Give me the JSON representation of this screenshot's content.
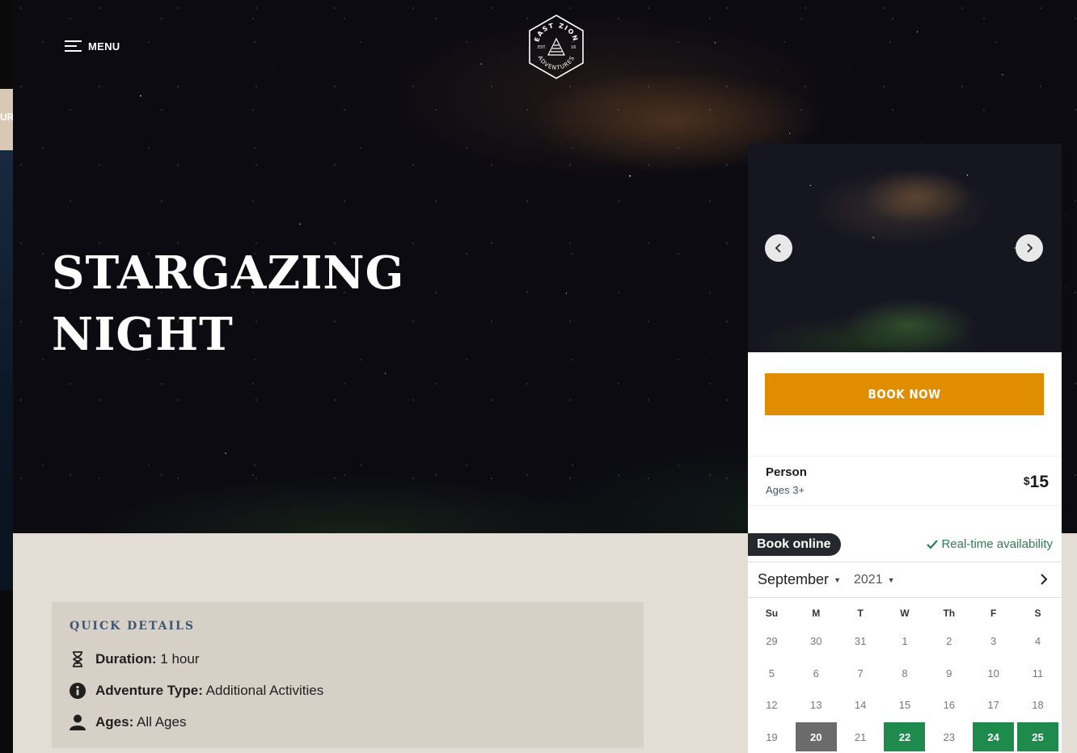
{
  "header": {
    "menu_label": "MENU",
    "logo_text_top": "EAST ZION",
    "logo_text_bottom": "ADVENTURES",
    "logo_est": "EST.",
    "logo_year": "16"
  },
  "left_strip_text": "UR",
  "hero": {
    "title_line1": "STARGAZING",
    "title_line2": "NIGHT"
  },
  "quick_details": {
    "title": "QUICK DETAILS",
    "items": [
      {
        "label": "Duration:",
        "value": "1 hour",
        "icon": "hourglass-icon"
      },
      {
        "label": "Adventure Type:",
        "value": "Additional Activities",
        "icon": "info-icon"
      },
      {
        "label": "Ages:",
        "value": "All Ages",
        "icon": "person-icon"
      }
    ]
  },
  "booking": {
    "book_now_label": "BOOK NOW",
    "person_label": "Person",
    "person_ages": "Ages 3+",
    "price_currency": "$",
    "price_value": "15",
    "book_online_label": "Book online",
    "realtime_label": "Real-time availability",
    "month": "September",
    "year": "2021",
    "weekdays": [
      "Su",
      "M",
      "T",
      "W",
      "Th",
      "F",
      "S"
    ],
    "weeks": [
      [
        "29",
        "30",
        "31",
        "1",
        "2",
        "3",
        "4"
      ],
      [
        "5",
        "6",
        "7",
        "8",
        "9",
        "10",
        "11"
      ],
      [
        "12",
        "13",
        "14",
        "15",
        "16",
        "17",
        "18"
      ],
      [
        "19",
        "20",
        "21",
        "22",
        "23",
        "24",
        "25"
      ]
    ],
    "today": "20",
    "available": [
      "22",
      "24",
      "25"
    ]
  },
  "colors": {
    "book_now": "#e08d00",
    "available": "#1e8a4c",
    "accent_text": "#3f5670",
    "content_bg": "#e3ddd6"
  }
}
